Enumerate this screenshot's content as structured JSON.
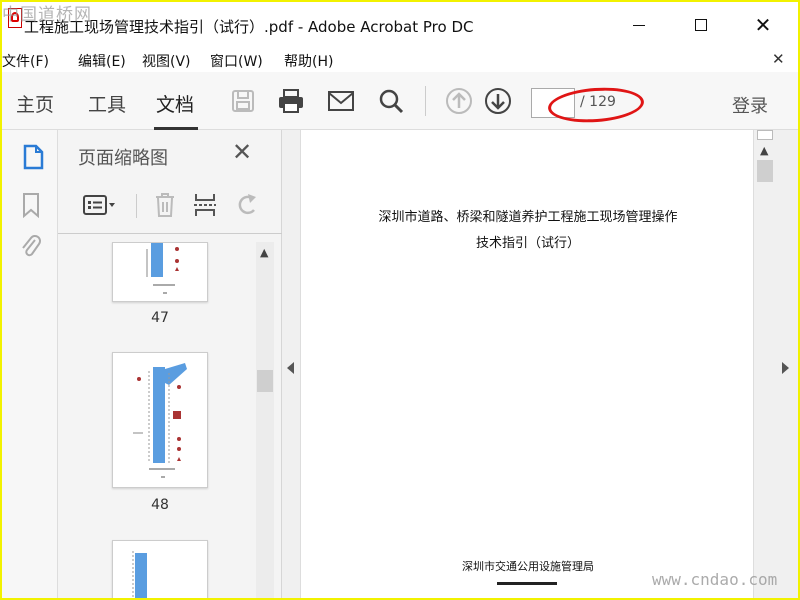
{
  "watermark": {
    "top_left": "中国道桥网",
    "bottom_right": "www.cndao.com"
  },
  "window": {
    "title": "工程施工现场管理技术指引（试行）.pdf - Adobe Acrobat Pro DC"
  },
  "menu": {
    "items": [
      "文件(F)",
      "编辑(E)",
      "视图(V)",
      "窗口(W)",
      "帮助(H)"
    ]
  },
  "toolbar": {
    "tabs": [
      "主页",
      "工具",
      "文档"
    ],
    "active_tab": "文档",
    "page_current": "",
    "page_total": "/ 129",
    "login_label": "登录",
    "annotation_color": "#e01515"
  },
  "thumbnails_panel": {
    "title": "页面缩略图",
    "pages": [
      {
        "number": "47"
      },
      {
        "number": "48"
      },
      {
        "number": ""
      }
    ]
  },
  "document": {
    "title_line1": "深圳市道路、桥梁和隧道养护工程施工现场管理操作",
    "title_line2": "技术指引（试行）",
    "organization": "深圳市交通公用设施管理局"
  }
}
